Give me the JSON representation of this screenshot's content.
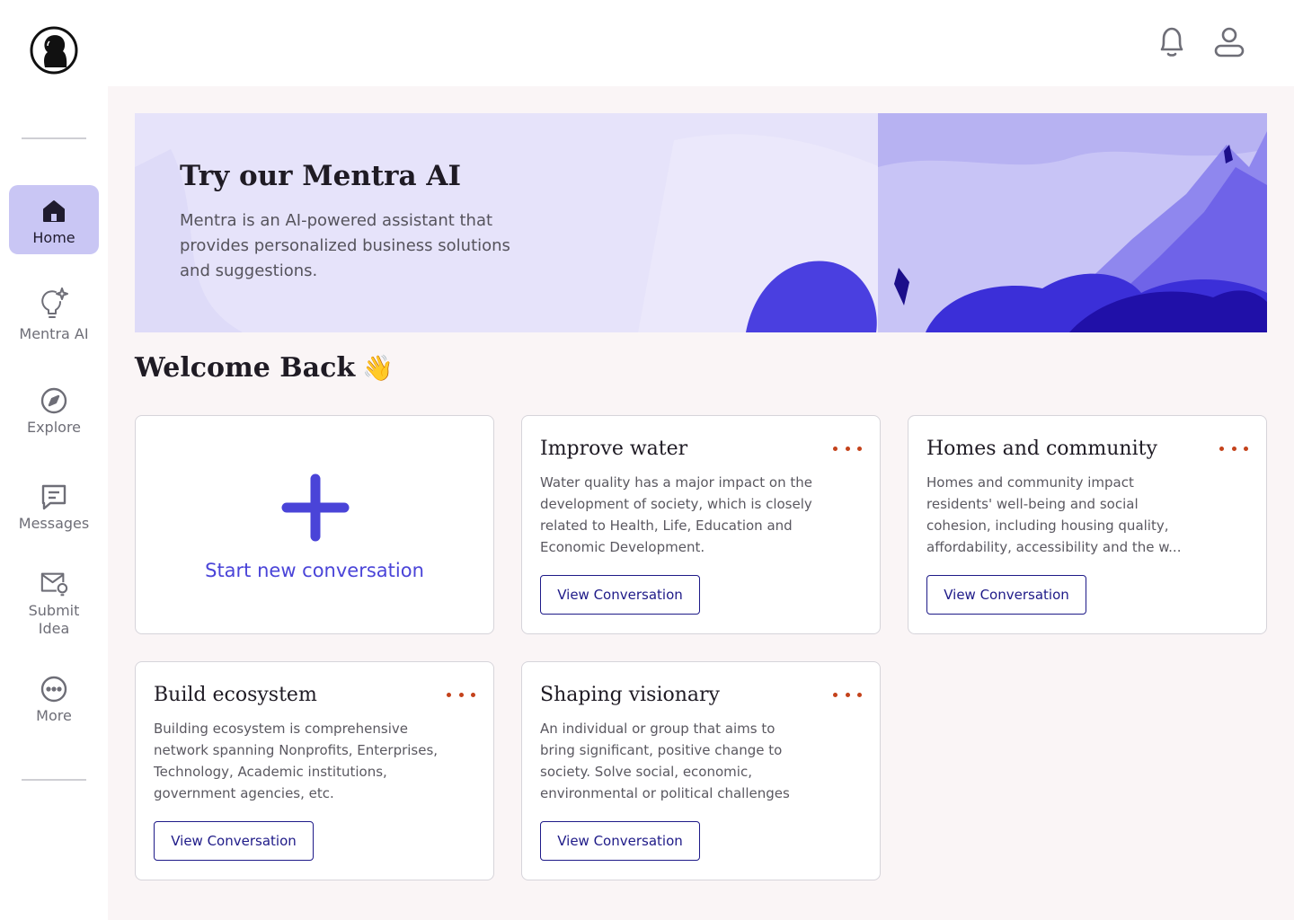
{
  "nav": {
    "items": [
      {
        "label": "Home",
        "icon": "home-icon"
      },
      {
        "label": "Mentra AI",
        "icon": "lightbulb-sparkle-icon"
      },
      {
        "label": "Explore",
        "icon": "compass-icon"
      },
      {
        "label": "Messages",
        "icon": "message-icon"
      },
      {
        "label": "Submit Idea",
        "icon": "mail-idea-icon"
      },
      {
        "label": "More",
        "icon": "more-circle-icon"
      }
    ],
    "active": "Home"
  },
  "topbar": {
    "icons": [
      "bell-icon",
      "user-icon"
    ]
  },
  "banner": {
    "title": "Try our Mentra AI",
    "description": "Mentra is an AI-powered assistant that provides personalized business solutions and suggestions."
  },
  "welcome": {
    "text": "Welcome Back",
    "emoji": "👋"
  },
  "new_conversation": {
    "label": "Start new conversation"
  },
  "cards": [
    {
      "title": "Improve water",
      "description": "Water quality has a major impact on the development of society, which is closely related to Health, Life, Education and Economic Development.",
      "button": "View Conversation"
    },
    {
      "title": "Homes and community",
      "description": "Homes and community impact residents' well-being and social cohesion, including housing quality, affordability, accessibility and the w...",
      "button": "View Conversation"
    },
    {
      "title": "Build ecosystem",
      "description": "Building ecosystem is comprehensive network spanning Nonprofits, Enterprises, Technology, Academic institutions, government agencies, etc.",
      "button": "View Conversation"
    },
    {
      "title": "Shaping visionary",
      "description": "An individual or group that aims to bring significant, positive change to society. Solve social, economic, environmental or political challenges",
      "button": "View Conversation"
    }
  ],
  "colors": {
    "accent": "#4a44d8",
    "nav_active_bg": "#c9c6f4",
    "button_border": "#1e1a88",
    "more_dots": "#c4421b",
    "main_bg": "#faf5f6"
  }
}
